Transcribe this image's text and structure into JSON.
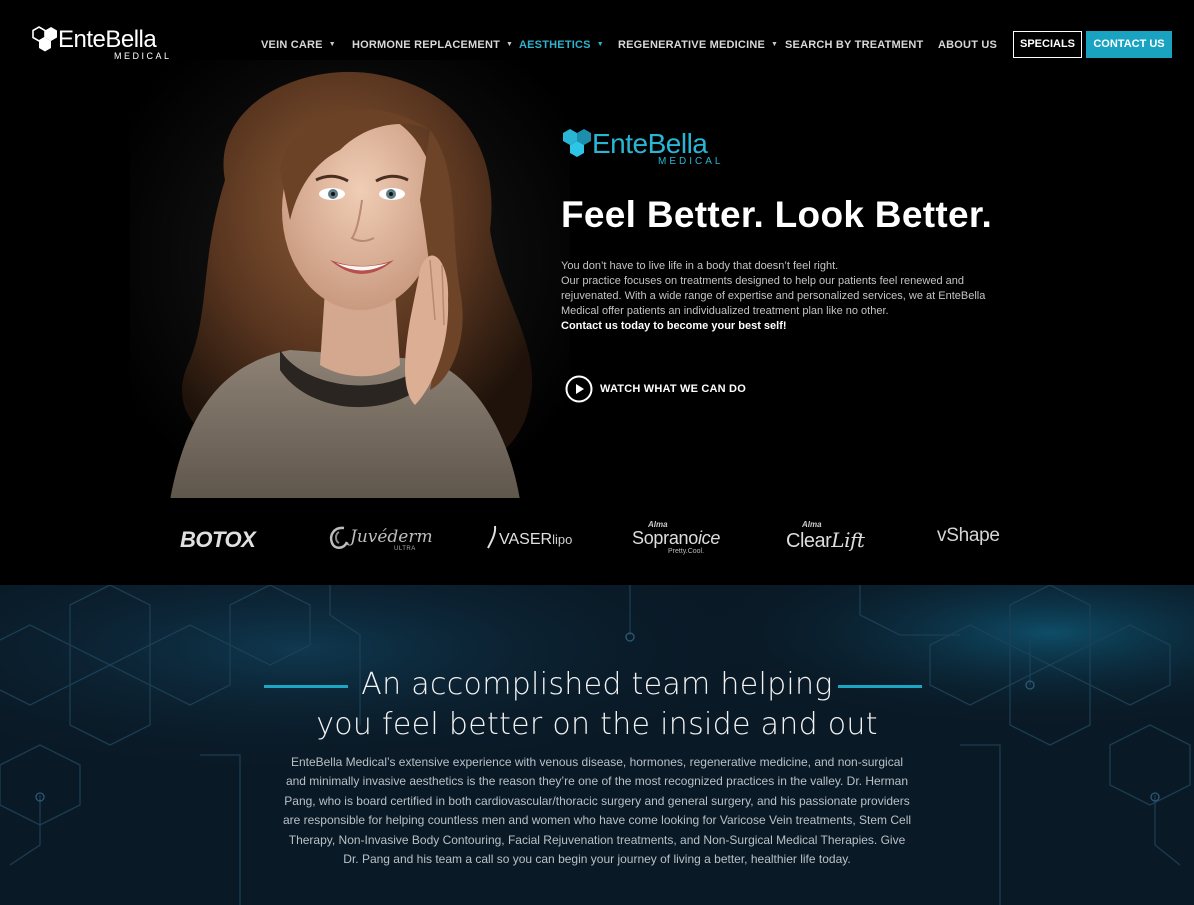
{
  "brand": {
    "name": "EnteBella",
    "sub": "MEDICAL"
  },
  "nav": {
    "items": [
      {
        "label": "VEIN CARE",
        "has_dropdown": true,
        "active": false
      },
      {
        "label": "HORMONE REPLACEMENT",
        "has_dropdown": true,
        "active": false
      },
      {
        "label": "AESTHETICS",
        "has_dropdown": true,
        "active": true
      },
      {
        "label": "REGENERATIVE MEDICINE",
        "has_dropdown": true,
        "active": false
      },
      {
        "label": "SEARCH BY TREATMENT",
        "has_dropdown": false,
        "active": false
      },
      {
        "label": "ABOUT US",
        "has_dropdown": false,
        "active": false
      }
    ],
    "specials_label": "SPECIALS",
    "contact_label": "CONTACT US"
  },
  "hero": {
    "logo_word": "EnteBella",
    "logo_sub": "MEDICAL",
    "title": "Feel Better. Look Better.",
    "line1": "You don’t have to live life in a body that doesn’t feel right.",
    "line2": "Our practice focuses on treatments designed to help our patients feel renewed and rejuvenated.   With a wide range of expertise and personalized services, we at EnteBella Medical offer patients an individualized treatment plan like no other.",
    "cta_text": "Contact us today to become your best self!",
    "watch_label": "WATCH WHAT WE CAN DO"
  },
  "brands": {
    "botox": "BOTOX",
    "juvederm": "Juvéderm",
    "juvederm_sub": "ULTRA",
    "vaser": "VASER",
    "vaser_lipo": "lipo",
    "soprano_alma": "Alma",
    "soprano": "Soprano",
    "soprano_ice": "ice",
    "soprano_sub": "Pretty.Cool.",
    "clearlift_alma": "Alma",
    "clearlift_clear": "Clear",
    "clearlift_lift": "Lift",
    "vshape": "vShape"
  },
  "about": {
    "title_line1": "An accomplished team helping",
    "title_line2": "you feel better on the inside and out",
    "body": "EnteBella Medical’s extensive experience with venous disease, hormones, regenerative medicine, and non-surgical and minimally invasive aesthetics is the reason they’re one of the most recognized practices in the valley. Dr. Herman Pang, who is board certified in both cardiovascular/thoracic surgery and general surgery, and his passionate providers are responsible for helping countless men and women who have come looking for Varicose Vein treatments, Stem Cell Therapy, Non-Invasive Body Contouring, Facial Rejuvenation treatments, and Non-Surgical Medical Therapies. Give Dr. Pang and his team a call so you can begin your journey of living a better, healthier life today."
  },
  "colors": {
    "accent": "#1aa3c0",
    "active_nav": "#2eb3cf",
    "background": "#000000",
    "section_bg": "#0a1a26"
  },
  "icons": [
    "hexagon-logo-icon",
    "play-circle-icon",
    "dropdown-caret-icon"
  ]
}
